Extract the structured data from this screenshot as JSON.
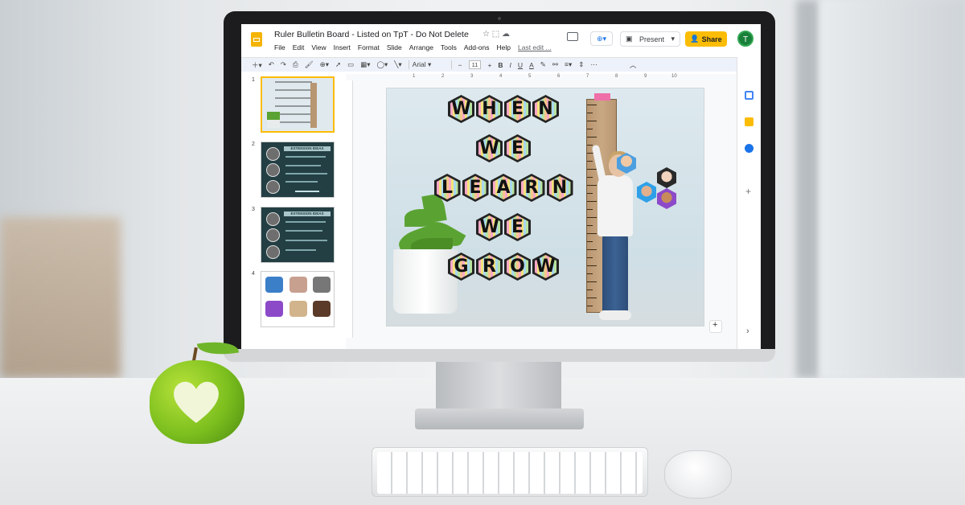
{
  "document": {
    "title": "Ruler Bulletin Board - Listed on TpT - Do Not Delete",
    "title_icons": "☆ ⬚ ☁",
    "menus": [
      "File",
      "Edit",
      "View",
      "Insert",
      "Format",
      "Slide",
      "Arrange",
      "Tools",
      "Add-ons",
      "Help"
    ],
    "last_edit": "Last edit ...",
    "present_label": "Present",
    "share_label": "Share",
    "avatar_initial": "T",
    "new_window_label": "⊕▾"
  },
  "toolbar": {
    "icons": [
      "add-icon",
      "undo-icon",
      "redo-icon",
      "print-icon",
      "paint-format-icon",
      "zoom-icon",
      "select-icon",
      "textbox-icon",
      "image-icon",
      "shape-icon",
      "line-icon"
    ],
    "font": "Arial",
    "font_size": "11",
    "bold": "B",
    "italic": "I",
    "underline": "U",
    "text_color": "A"
  },
  "ruler_numbers": [
    "1",
    "2",
    "3",
    "4",
    "5",
    "6",
    "7",
    "8",
    "9",
    "10"
  ],
  "slides": [
    {
      "num": "1",
      "kind": "title"
    },
    {
      "num": "2",
      "heading": "EXTENSION IDEAS"
    },
    {
      "num": "3",
      "heading": "EXTENSION IDEAS"
    },
    {
      "num": "4",
      "kind": "grid"
    }
  ],
  "main_slide": {
    "rows": [
      [
        "W",
        "H",
        "E",
        "N"
      ],
      [
        "W",
        "E"
      ],
      [
        "L",
        "E",
        "A",
        "R",
        "N"
      ],
      [
        "W",
        "E"
      ],
      [
        "G",
        "R",
        "O",
        "W"
      ]
    ]
  },
  "colors": {
    "accent_yellow": "#fbbc04",
    "slide_bg": "#dde9ee",
    "thumb_dark": "#233f44",
    "apple": "#7cbf1e"
  }
}
